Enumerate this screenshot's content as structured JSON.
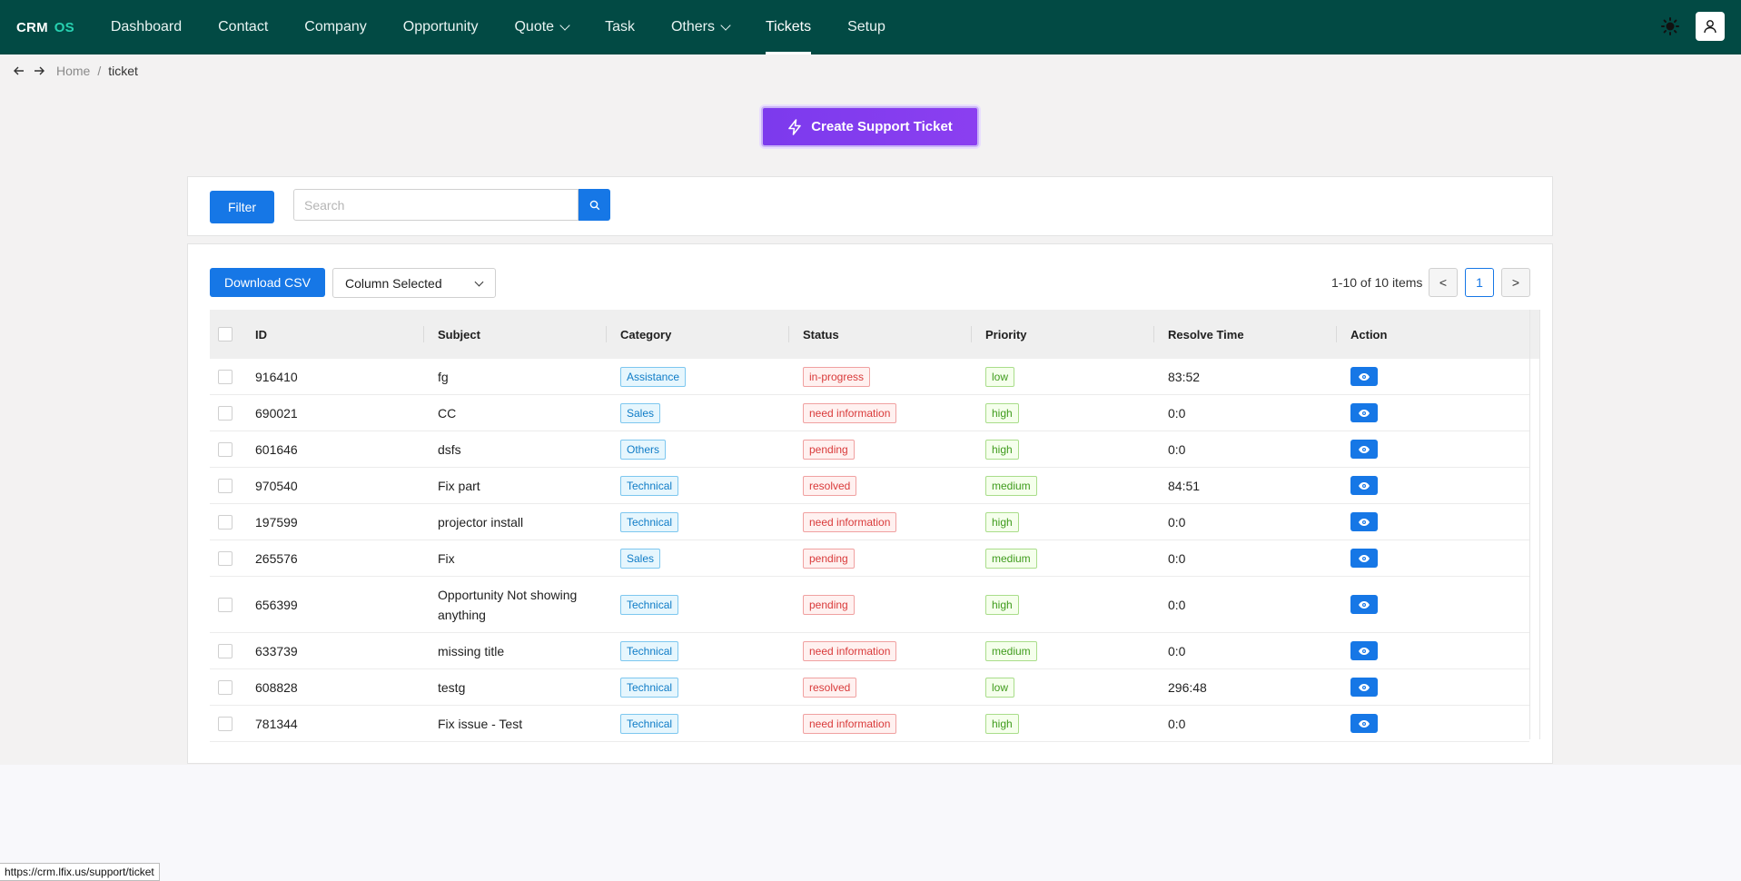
{
  "app": {
    "logo_main": "CRM",
    "logo_accent": "OS"
  },
  "nav": {
    "items": [
      {
        "label": "Dashboard",
        "dropdown": false,
        "active": false
      },
      {
        "label": "Contact",
        "dropdown": false,
        "active": false
      },
      {
        "label": "Company",
        "dropdown": false,
        "active": false
      },
      {
        "label": "Opportunity",
        "dropdown": false,
        "active": false
      },
      {
        "label": "Quote",
        "dropdown": true,
        "active": false
      },
      {
        "label": "Task",
        "dropdown": false,
        "active": false
      },
      {
        "label": "Others",
        "dropdown": true,
        "active": false
      },
      {
        "label": "Tickets",
        "dropdown": false,
        "active": true
      },
      {
        "label": "Setup",
        "dropdown": false,
        "active": false
      }
    ]
  },
  "breadcrumb": {
    "home": "Home",
    "separator": "/",
    "current": "ticket"
  },
  "create_button": {
    "label": "Create Support Ticket"
  },
  "filter": {
    "button_label": "Filter",
    "search_placeholder": "Search",
    "search_value": ""
  },
  "toolbar": {
    "csv_label": "Download CSV",
    "column_select": "Column Selected"
  },
  "pagination": {
    "summary": "1-10 of 10 items",
    "current_page": "1",
    "prev": "<",
    "next": ">"
  },
  "table": {
    "headers": [
      "ID",
      "Subject",
      "Category",
      "Status",
      "Priority",
      "Resolve Time",
      "Action"
    ],
    "rows": [
      {
        "id": "916410",
        "subject": "fg",
        "category": "Assistance",
        "status": "in-progress",
        "priority": "low",
        "resolve_time": "83:52"
      },
      {
        "id": "690021",
        "subject": "CC",
        "category": "Sales",
        "status": "need information",
        "priority": "high",
        "resolve_time": "0:0"
      },
      {
        "id": "601646",
        "subject": "dsfs",
        "category": "Others",
        "status": "pending",
        "priority": "high",
        "resolve_time": "0:0"
      },
      {
        "id": "970540",
        "subject": "Fix part",
        "category": "Technical",
        "status": "resolved",
        "priority": "medium",
        "resolve_time": "84:51"
      },
      {
        "id": "197599",
        "subject": "projector install",
        "category": "Technical",
        "status": "need information",
        "priority": "high",
        "resolve_time": "0:0"
      },
      {
        "id": "265576",
        "subject": "Fix",
        "category": "Sales",
        "status": "pending",
        "priority": "medium",
        "resolve_time": "0:0"
      },
      {
        "id": "656399",
        "subject": "Opportunity Not showing anything",
        "category": "Technical",
        "status": "pending",
        "priority": "high",
        "resolve_time": "0:0"
      },
      {
        "id": "633739",
        "subject": "missing title",
        "category": "Technical",
        "status": "need information",
        "priority": "medium",
        "resolve_time": "0:0"
      },
      {
        "id": "608828",
        "subject": "testg",
        "category": "Technical",
        "status": "resolved",
        "priority": "low",
        "resolve_time": "296:48"
      },
      {
        "id": "781344",
        "subject": "Fix issue - Test",
        "category": "Technical",
        "status": "need information",
        "priority": "high",
        "resolve_time": "0:0"
      }
    ]
  },
  "status_bar_url": "https://crm.lfix.us/support/ticket",
  "colors": {
    "nav_bg": "#024a44",
    "accent_blue": "#1677e6",
    "accent_purple": "#7c3aed",
    "logo_accent": "#27d1b1"
  }
}
